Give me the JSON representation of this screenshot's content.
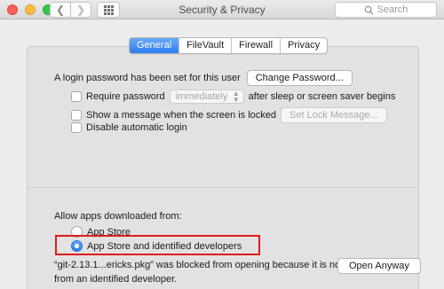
{
  "window": {
    "title": "Security & Privacy"
  },
  "toolbar": {
    "search_placeholder": "Search"
  },
  "tabs": [
    {
      "label": "General",
      "active": true
    },
    {
      "label": "FileVault",
      "active": false
    },
    {
      "label": "Firewall",
      "active": false
    },
    {
      "label": "Privacy",
      "active": false
    }
  ],
  "general": {
    "login_password_text": "A login password has been set for this user",
    "change_password_label": "Change Password...",
    "require_password_label": "Require password",
    "require_password_value": "immediately",
    "after_sleep_text": "after sleep or screen saver begins",
    "show_message_label": "Show a message when the screen is locked",
    "set_lock_message_label": "Set Lock Message...",
    "disable_auto_login_label": "Disable automatic login"
  },
  "downloads": {
    "heading": "Allow apps downloaded from:",
    "options": [
      {
        "label": "App Store",
        "selected": false
      },
      {
        "label": "App Store and identified developers",
        "selected": true
      }
    ],
    "blocked_line1": "“git-2.13.1...ericks.pkg” was blocked from opening because it is not",
    "blocked_line2": "from an identified developer.",
    "open_anyway_label": "Open Anyway"
  },
  "colors": {
    "accent": "#2c7cf0",
    "highlight_box": "#e01b1b"
  }
}
